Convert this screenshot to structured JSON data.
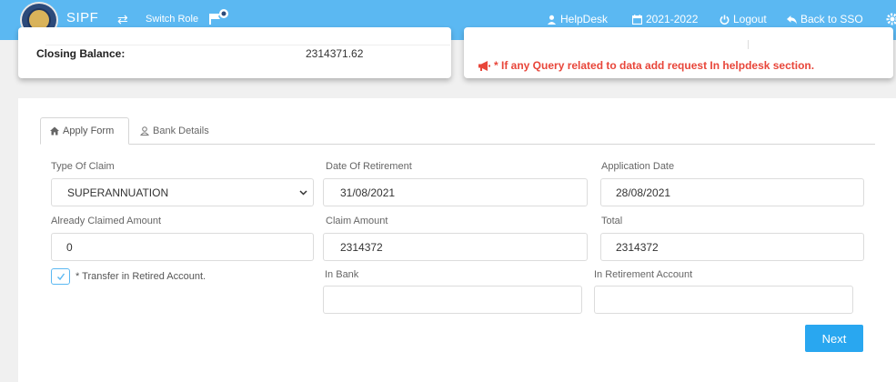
{
  "header": {
    "brand": "SIPF",
    "switch_role": "Switch Role",
    "nav": {
      "helpdesk": "HelpDesk",
      "year": "2021-2022",
      "logout": "Logout",
      "back": "Back to SSO"
    }
  },
  "summary": {
    "closing_label": "Closing Balance:",
    "closing_value": "2314371.62",
    "notice": "* If any Query related to data add request In helpdesk section."
  },
  "tabs": {
    "apply": "Apply Form",
    "bank": "Bank Details"
  },
  "form": {
    "type_of_claim": {
      "label": "Type Of Claim",
      "value": "SUPERANNUATION"
    },
    "date_of_retirement": {
      "label": "Date Of Retirement",
      "value": "31/08/2021"
    },
    "application_date": {
      "label": "Application Date",
      "value": "28/08/2021"
    },
    "already_claimed": {
      "label": "Already Claimed Amount",
      "value": "0"
    },
    "claim_amount": {
      "label": "Claim Amount",
      "value": "2314372"
    },
    "total": {
      "label": "Total",
      "value": "2314372"
    },
    "transfer_label": "* Transfer in Retired Account.",
    "transfer_checked": true,
    "in_bank": {
      "label": "In Bank",
      "value": ""
    },
    "in_retirement": {
      "label": "In Retirement Account",
      "value": ""
    },
    "next": "Next"
  },
  "colors": {
    "topbar": "#5bb8f2",
    "notice": "#e8463a",
    "button": "#29a7f0"
  }
}
